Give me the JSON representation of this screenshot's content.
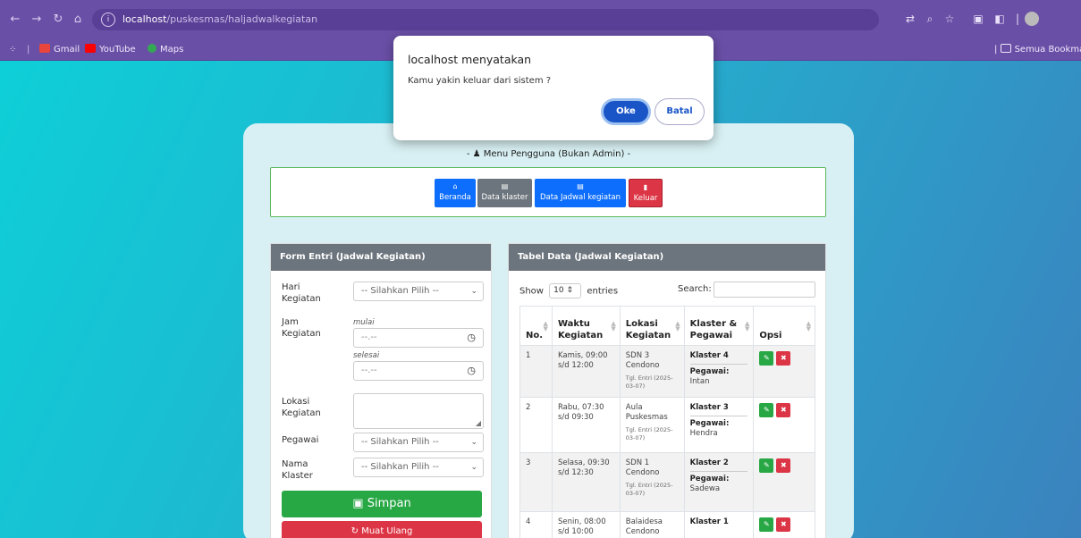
{
  "browser": {
    "url_host": "localhost",
    "url_path": "/puskesmas/haljadwalkegiatan",
    "bookmarks": [
      "Gmail",
      "YouTube",
      "Maps"
    ],
    "all_bookmarks": "Semua Bookma"
  },
  "menu": {
    "title": "- ♟ Menu Pengguna (Bukan Admin) -",
    "buttons": [
      {
        "label": "Beranda",
        "icon": "home-icon",
        "color": "#0d6efd"
      },
      {
        "label": "Data klaster",
        "icon": "table-icon",
        "color": "#6c757d"
      },
      {
        "label": "Data Jadwal kegiatan",
        "icon": "table-icon",
        "color": "#0d6efd"
      },
      {
        "label": "Keluar",
        "icon": "bookmark-icon",
        "color": "#dc3545"
      }
    ]
  },
  "form": {
    "title": "Form Entri (Jadwal Kegiatan)",
    "hari_label": "Hari Kegiatan",
    "hari_value": "-- Silahkan Pilih --",
    "jam_label": "Jam Kegiatan",
    "mulai": "mulai",
    "selesai": "selesai",
    "time_placeholder": "--.--",
    "lokasi_label": "Lokasi Kegiatan",
    "pegawai_label": "Pegawai",
    "pegawai_value": "-- Silahkan Pilih --",
    "klaster_label": "Nama Klaster",
    "klaster_value": "-- Silahkan Pilih --",
    "save_label": "Simpan",
    "reload_label": "Muat Ulang"
  },
  "table": {
    "title": "Tabel Data (Jadwal Kegiatan)",
    "show": "Show",
    "entries_value": "10",
    "entries": "entries",
    "search_label": "Search:",
    "columns": [
      "No.",
      "Waktu Kegiatan",
      "Lokasi Kegiatan",
      "Klaster & Pegawai",
      "Opsi"
    ],
    "rows": [
      {
        "no": "1",
        "waktu": "Kamis, 09:00 s/d 12:00",
        "lokasi": "SDN 3 Cendono",
        "tgl": "Tgl. Entri (2025-03-07)",
        "klaster": "Klaster 4",
        "pegawai_label": "Pegawai:",
        "pegawai": "Intan"
      },
      {
        "no": "2",
        "waktu": "Rabu, 07:30 s/d 09:30",
        "lokasi": "Aula Puskesmas",
        "tgl": "Tgl. Entri (2025-03-07)",
        "klaster": "Klaster 3",
        "pegawai_label": "Pegawai:",
        "pegawai": "Hendra"
      },
      {
        "no": "3",
        "waktu": "Selasa, 09:30 s/d 12:30",
        "lokasi": "SDN 1 Cendono",
        "tgl": "Tgl. Entri (2025-03-07)",
        "klaster": "Klaster 2",
        "pegawai_label": "Pegawai:",
        "pegawai": "Sadewa"
      },
      {
        "no": "4",
        "waktu": "Senin, 08:00 s/d 10:00",
        "lokasi": "Balaidesa Cendono",
        "tgl": "",
        "klaster": "Klaster 1",
        "pegawai_label": "",
        "pegawai": ""
      }
    ]
  },
  "dialog": {
    "title": "localhost menyatakan",
    "message": "Kamu yakin keluar dari sistem ?",
    "ok": "Oke",
    "cancel": "Batal"
  },
  "colors": {
    "success": "#28a745",
    "danger": "#dc3545",
    "primary": "#0d6efd",
    "secondary": "#6c757d"
  }
}
